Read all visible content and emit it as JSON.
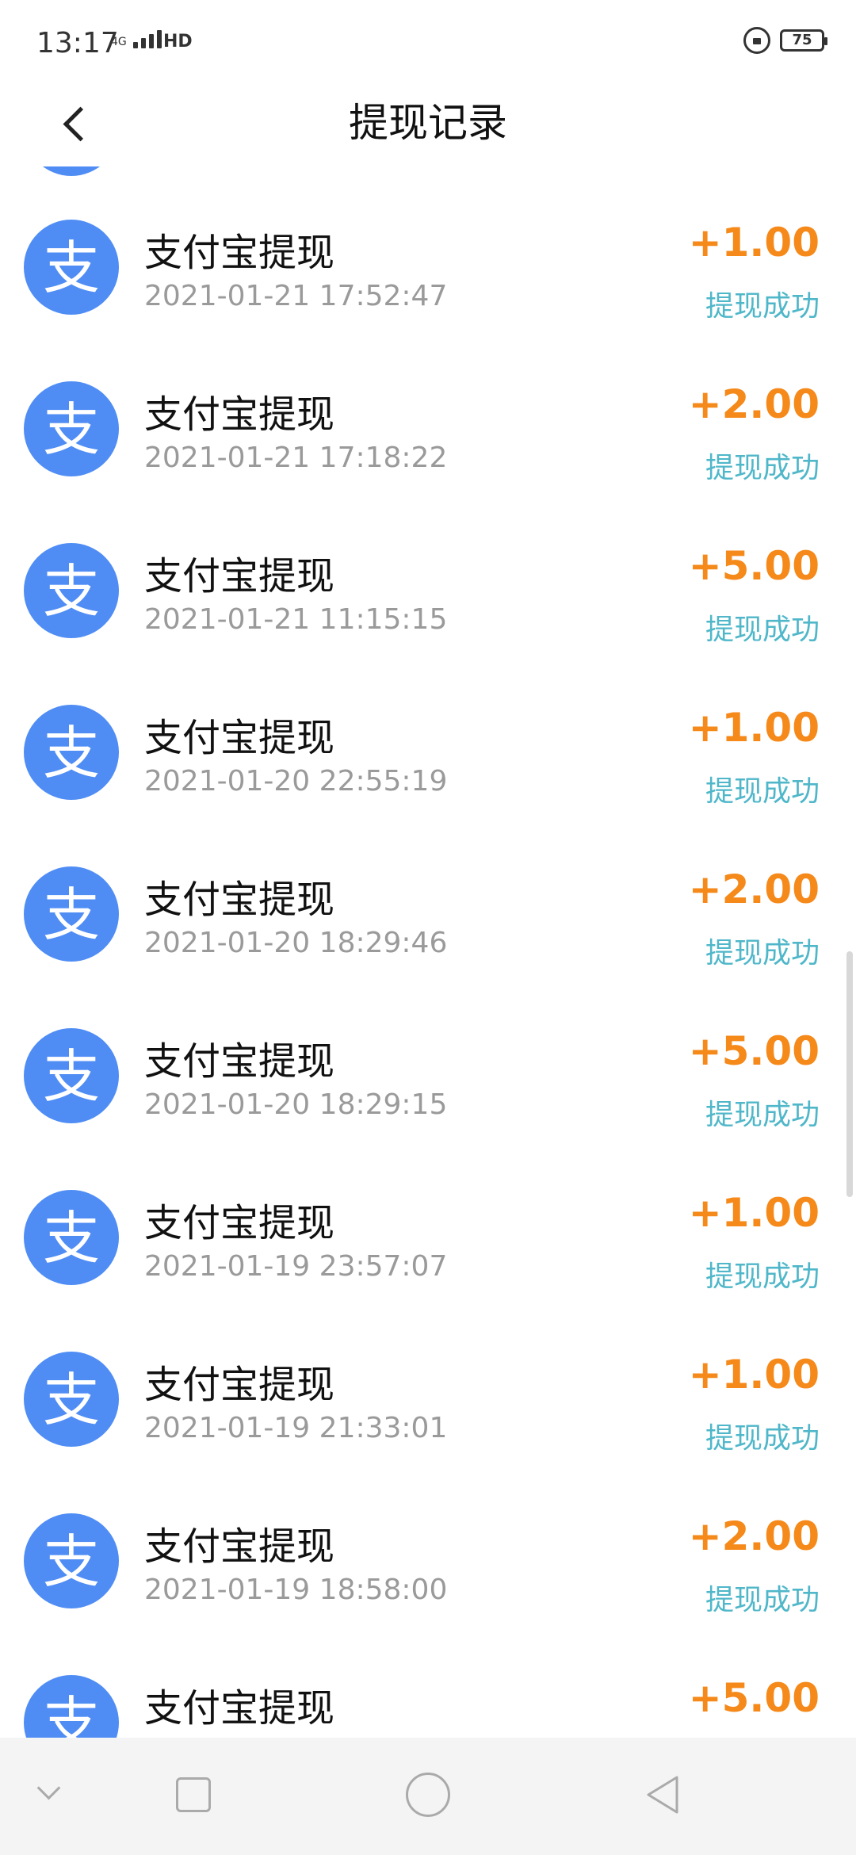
{
  "status_bar": {
    "time": "13:17",
    "network": "4G",
    "hd": "HD",
    "battery": "75"
  },
  "header": {
    "title": "提现记录"
  },
  "colors": {
    "amount": "#F5891A",
    "status": "#4FB7C9",
    "avatar_bg": "#4F8DF5"
  },
  "records": [
    {
      "title": "支付宝提现",
      "time": "2021-01-21 17:52:47",
      "amount": "+1.00",
      "status": "提现成功"
    },
    {
      "title": "支付宝提现",
      "time": "2021-01-21 17:18:22",
      "amount": "+2.00",
      "status": "提现成功"
    },
    {
      "title": "支付宝提现",
      "time": "2021-01-21 11:15:15",
      "amount": "+5.00",
      "status": "提现成功"
    },
    {
      "title": "支付宝提现",
      "time": "2021-01-20 22:55:19",
      "amount": "+1.00",
      "status": "提现成功"
    },
    {
      "title": "支付宝提现",
      "time": "2021-01-20 18:29:46",
      "amount": "+2.00",
      "status": "提现成功"
    },
    {
      "title": "支付宝提现",
      "time": "2021-01-20 18:29:15",
      "amount": "+5.00",
      "status": "提现成功"
    },
    {
      "title": "支付宝提现",
      "time": "2021-01-19 23:57:07",
      "amount": "+1.00",
      "status": "提现成功"
    },
    {
      "title": "支付宝提现",
      "time": "2021-01-19 21:33:01",
      "amount": "+1.00",
      "status": "提现成功"
    },
    {
      "title": "支付宝提现",
      "time": "2021-01-19 18:58:00",
      "amount": "+2.00",
      "status": "提现成功"
    },
    {
      "title": "支付宝提现",
      "time": "",
      "amount": "+5.00",
      "status": ""
    }
  ],
  "nav_bar": {
    "icons": [
      "chevron-down-icon",
      "recents-square-icon",
      "home-circle-icon",
      "back-triangle-icon"
    ]
  }
}
